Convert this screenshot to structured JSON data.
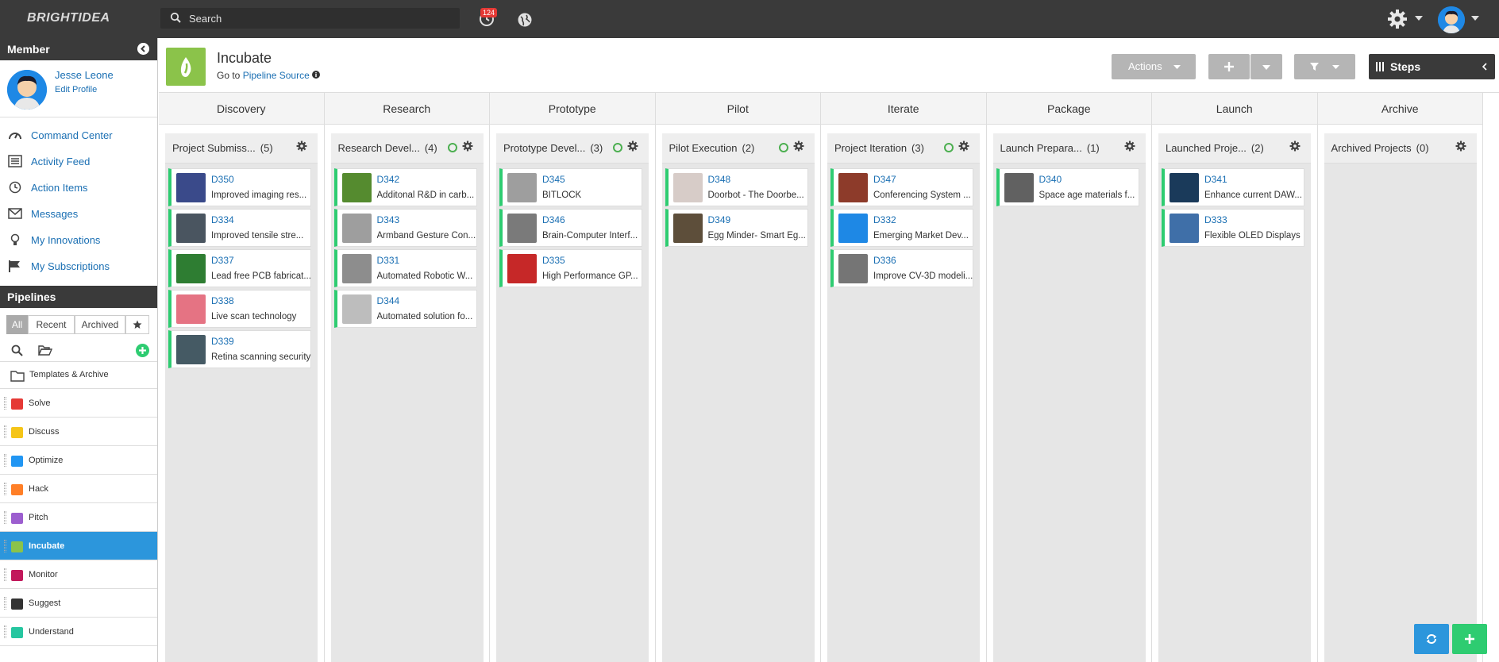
{
  "topbar": {
    "logo": "BRIGHTIDEA",
    "search_placeholder": "Search",
    "notification_count": "124"
  },
  "sidebar": {
    "member_title": "Member",
    "user_name": "Jesse Leone",
    "edit_profile": "Edit Profile",
    "menu": [
      {
        "label": "Command Center",
        "icon": "dashboard-icon"
      },
      {
        "label": "Activity Feed",
        "icon": "feed-icon"
      },
      {
        "label": "Action Items",
        "icon": "clock-icon"
      },
      {
        "label": "Messages",
        "icon": "envelope-icon"
      },
      {
        "label": "My Innovations",
        "icon": "lightbulb-icon"
      },
      {
        "label": "My Subscriptions",
        "icon": "flag-icon"
      }
    ],
    "pipelines_title": "Pipelines",
    "tabs": [
      "All",
      "Recent",
      "Archived"
    ],
    "templates_label": "Templates & Archive",
    "pipelines": [
      {
        "label": "Solve",
        "color": "#e53935"
      },
      {
        "label": "Discuss",
        "color": "#f5c518"
      },
      {
        "label": "Optimize",
        "color": "#2196f3"
      },
      {
        "label": "Hack",
        "color": "#ff7f27"
      },
      {
        "label": "Pitch",
        "color": "#9c5ecf"
      },
      {
        "label": "Incubate",
        "color": "#8bc34a"
      },
      {
        "label": "Monitor",
        "color": "#c2185b"
      },
      {
        "label": "Suggest",
        "color": "#333333"
      },
      {
        "label": "Understand",
        "color": "#26c6a0"
      }
    ]
  },
  "header": {
    "title": "Incubate",
    "goto_prefix": "Go to",
    "goto_link": "Pipeline Source",
    "actions_label": "Actions",
    "steps_label": "Steps"
  },
  "stages": [
    {
      "name": "Discovery",
      "lane": "Project Submiss...",
      "count": "(5)",
      "clock": false,
      "cards": [
        {
          "id": "D350",
          "text": "Improved imaging res...",
          "thumb": "#3a4a8a"
        },
        {
          "id": "D334",
          "text": "Improved tensile stre...",
          "thumb": "#4a5560"
        },
        {
          "id": "D337",
          "text": "Lead free PCB fabricat...",
          "thumb": "#2e7d32"
        },
        {
          "id": "D338",
          "text": "Live scan technology",
          "thumb": "#e57383"
        },
        {
          "id": "D339",
          "text": "Retina scanning security",
          "thumb": "#455a64"
        }
      ]
    },
    {
      "name": "Research",
      "lane": "Research Devel...",
      "count": "(4)",
      "clock": true,
      "cards": [
        {
          "id": "D342",
          "text": "Additonal R&D in carb...",
          "thumb": "#558b2f"
        },
        {
          "id": "D343",
          "text": "Armband Gesture Con...",
          "thumb": "#9e9e9e"
        },
        {
          "id": "D331",
          "text": "Automated Robotic W...",
          "thumb": "#8d8d8d"
        },
        {
          "id": "D344",
          "text": "Automated solution fo...",
          "thumb": "#bdbdbd"
        }
      ]
    },
    {
      "name": "Prototype",
      "lane": "Prototype Devel...",
      "count": "(3)",
      "clock": true,
      "cards": [
        {
          "id": "D345",
          "text": "BITLOCK",
          "thumb": "#9e9e9e"
        },
        {
          "id": "D346",
          "text": "Brain-Computer Interf...",
          "thumb": "#7a7a7a"
        },
        {
          "id": "D335",
          "text": "High Performance GP...",
          "thumb": "#c62828"
        }
      ]
    },
    {
      "name": "Pilot",
      "lane": "Pilot Execution",
      "count": "(2)",
      "clock": true,
      "cards": [
        {
          "id": "D348",
          "text": "Doorbot - The Doorbe...",
          "thumb": "#d7ccc8"
        },
        {
          "id": "D349",
          "text": "Egg Minder- Smart Eg...",
          "thumb": "#5d4e3a"
        }
      ]
    },
    {
      "name": "Iterate",
      "lane": "Project Iteration",
      "count": "(3)",
      "clock": true,
      "cards": [
        {
          "id": "D347",
          "text": "Conferencing System ...",
          "thumb": "#8d3b2a"
        },
        {
          "id": "D332",
          "text": "Emerging Market Dev...",
          "thumb": "#1e88e5"
        },
        {
          "id": "D336",
          "text": "Improve CV-3D modeli...",
          "thumb": "#757575"
        }
      ]
    },
    {
      "name": "Package",
      "lane": "Launch Prepara...",
      "count": "(1)",
      "clock": false,
      "cards": [
        {
          "id": "D340",
          "text": "Space age materials f...",
          "thumb": "#616161"
        }
      ]
    },
    {
      "name": "Launch",
      "lane": "Launched Proje...",
      "count": "(2)",
      "clock": false,
      "cards": [
        {
          "id": "D341",
          "text": "Enhance current DAW...",
          "thumb": "#1a3a5a"
        },
        {
          "id": "D333",
          "text": "Flexible OLED Displays",
          "thumb": "#3f6fa8"
        }
      ]
    },
    {
      "name": "Archive",
      "lane": "Archived Projects",
      "count": "(0)",
      "clock": false,
      "cards": []
    }
  ]
}
